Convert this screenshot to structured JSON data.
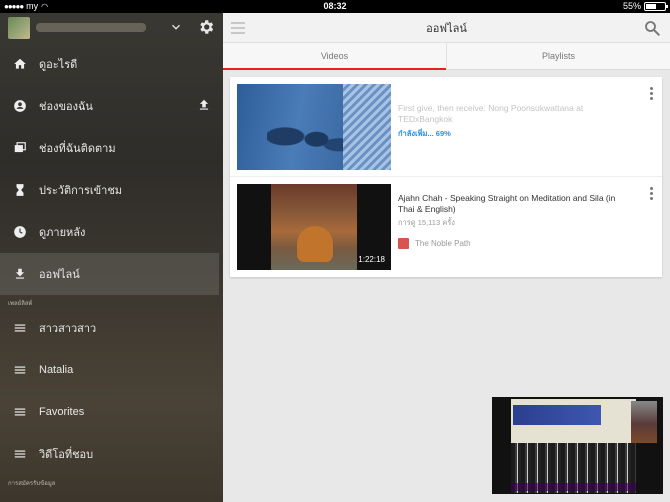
{
  "status_bar": {
    "carrier": "my",
    "time": "08:32",
    "battery": "55%",
    "battery_level": 0.55
  },
  "sidebar": {
    "nav": [
      {
        "label": "ดูอะไรดี",
        "icon": "home-icon"
      },
      {
        "label": "ช่องของฉัน",
        "icon": "account-icon"
      },
      {
        "label": "ช่องที่ฉันติดตาม",
        "icon": "subscriptions-icon"
      },
      {
        "label": "ประวัติการเข้าชม",
        "icon": "hourglass-icon"
      },
      {
        "label": "ดูภายหลัง",
        "icon": "clock-icon"
      },
      {
        "label": "ออฟไลน์",
        "icon": "download-icon"
      }
    ],
    "playlists_header": "เพลย์ลิสต์",
    "playlists": [
      {
        "label": "สาวสาวสาว",
        "icon": "playlist-icon"
      },
      {
        "label": "Natalia",
        "icon": "playlist-icon"
      },
      {
        "label": "Favorites",
        "icon": "playlist-icon"
      },
      {
        "label": "วิดีโอที่ชอบ",
        "icon": "playlist-icon"
      }
    ],
    "subscriptions_header": "การสมัครรับข้อมูล"
  },
  "appbar": {
    "title": "ออฟไลน์"
  },
  "tabs": [
    {
      "label": "Videos"
    },
    {
      "label": "Playlists"
    }
  ],
  "videos": [
    {
      "title": "First give, then receive: Nong Poonsukwattana at TEDxBangkok",
      "progress_text": "กำลังเพิ่ม... 69%",
      "progress": 0.69
    },
    {
      "title": "Ajahn Chah - Speaking Straight on Meditation and Sila (in Thai & English)",
      "views": "การดู 15,113 ครั้ง",
      "channel": "The Noble Path",
      "duration": "1:22:18"
    }
  ],
  "colors": {
    "accent": "#e62117",
    "progress": "#2793e6"
  }
}
